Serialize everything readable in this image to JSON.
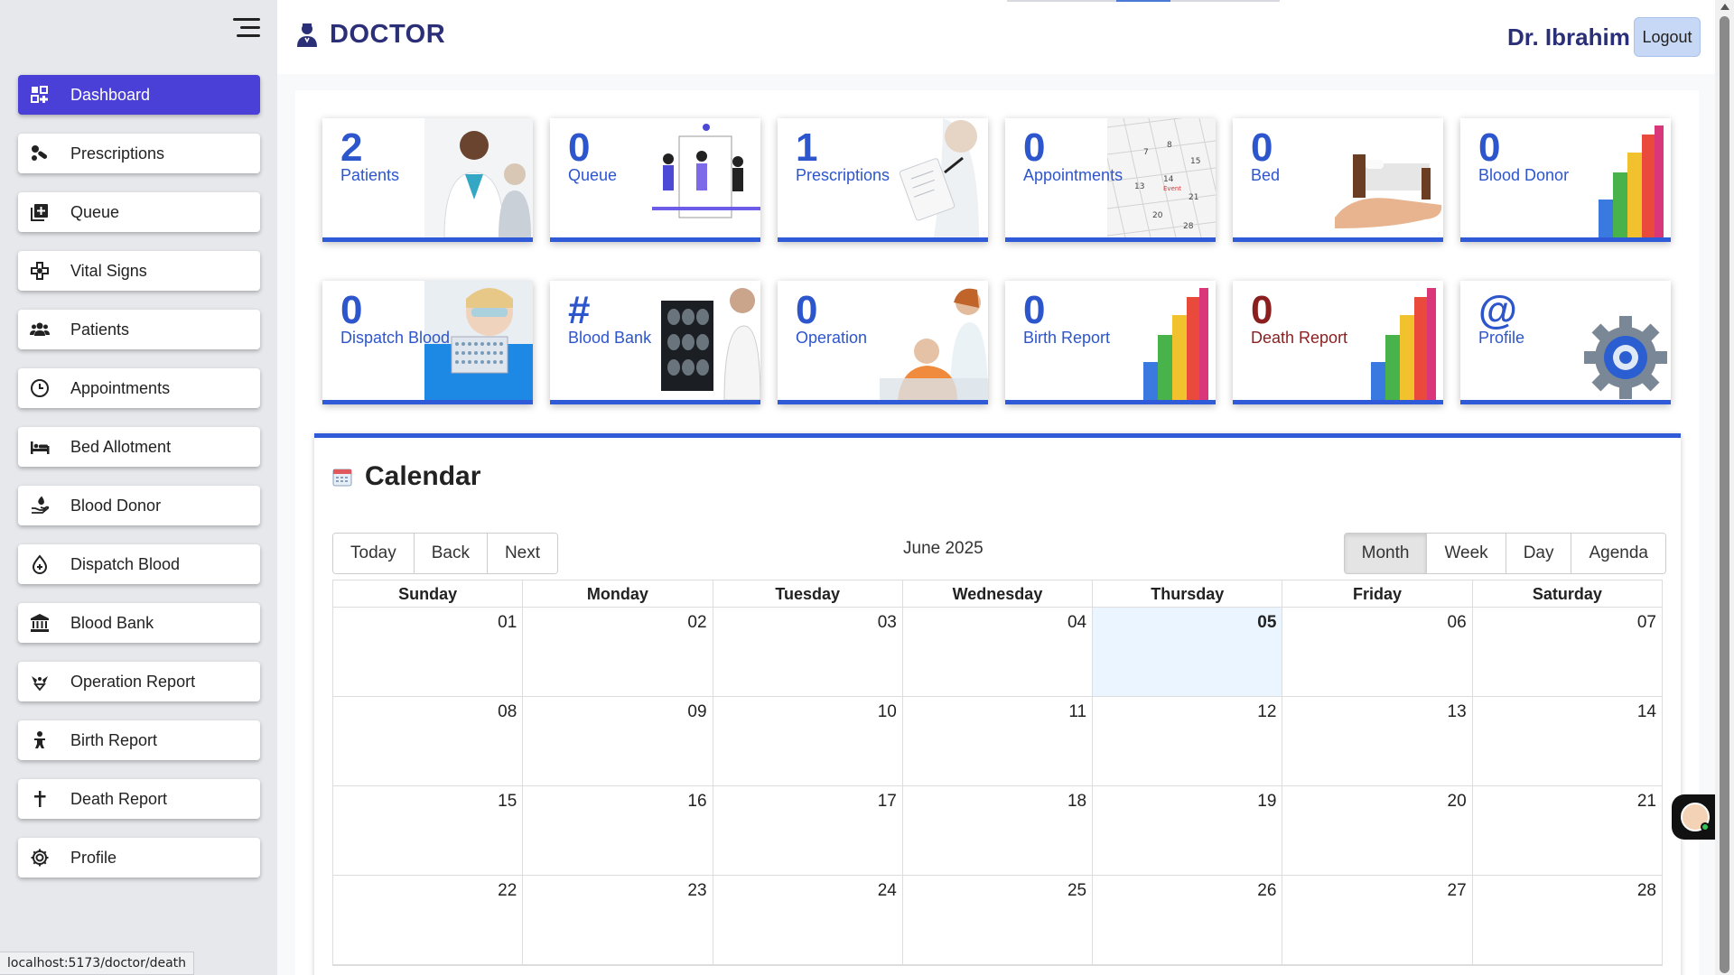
{
  "header": {
    "brand": "DOCTOR",
    "brand_icon": "doctor-icon",
    "user_name": "Dr. Ibrahim",
    "logout_label": "Logout"
  },
  "sidebar": {
    "items": [
      {
        "label": "Dashboard",
        "icon": "dashboard-icon",
        "active": true
      },
      {
        "label": "Prescriptions",
        "icon": "pills-icon"
      },
      {
        "label": "Queue",
        "icon": "queue-add-icon"
      },
      {
        "label": "Vital Signs",
        "icon": "medical-cross-icon"
      },
      {
        "label": "Patients",
        "icon": "users-icon"
      },
      {
        "label": "Appointments",
        "icon": "clock-icon"
      },
      {
        "label": "Bed Allotment",
        "icon": "bed-icon"
      },
      {
        "label": "Blood Donor",
        "icon": "hand-donate-icon"
      },
      {
        "label": "Dispatch Blood",
        "icon": "blood-drop-icon"
      },
      {
        "label": "Blood Bank",
        "icon": "bank-icon"
      },
      {
        "label": "Operation Report",
        "icon": "surgery-icon"
      },
      {
        "label": "Birth Report",
        "icon": "baby-icon"
      },
      {
        "label": "Death Report",
        "icon": "cross-icon"
      },
      {
        "label": "Profile",
        "icon": "gear-icon"
      }
    ]
  },
  "status_url": "localhost:5173/doctor/death",
  "cards": [
    {
      "value": "2",
      "label": "Patients",
      "art": "doctor-patient-image"
    },
    {
      "value": "0",
      "label": "Queue",
      "art": "queue-people-image"
    },
    {
      "value": "1",
      "label": "Prescriptions",
      "art": "prescription-clipboard-image"
    },
    {
      "value": "0",
      "label": "Appointments",
      "art": "calendar-page-image"
    },
    {
      "value": "0",
      "label": "Bed",
      "art": "bed-in-hand-image"
    },
    {
      "value": "0",
      "label": "Blood Donor",
      "art": "bar-chart-image"
    },
    {
      "value": "0",
      "label": "Dispatch Blood",
      "art": "lab-scientist-image"
    },
    {
      "value": "#",
      "label": "Blood Bank",
      "art": "xray-doctor-image"
    },
    {
      "value": "0",
      "label": "Operation",
      "art": "nurse-patient-image"
    },
    {
      "value": "0",
      "label": "Birth Report",
      "art": "bar-chart-image"
    },
    {
      "value": "0",
      "label": "Death Report",
      "art": "bar-chart-image",
      "dark": true
    },
    {
      "value": "@",
      "label": "Profile",
      "art": "gear-image"
    }
  ],
  "calendar": {
    "title": "Calendar",
    "nav_buttons": [
      "Today",
      "Back",
      "Next"
    ],
    "label": "June 2025",
    "views": [
      "Month",
      "Week",
      "Day",
      "Agenda"
    ],
    "active_view": "Month",
    "weekdays": [
      "Sunday",
      "Monday",
      "Tuesday",
      "Wednesday",
      "Thursday",
      "Friday",
      "Saturday"
    ],
    "weeks": [
      [
        "01",
        "02",
        "03",
        "04",
        "05",
        "06",
        "07"
      ],
      [
        "08",
        "09",
        "10",
        "11",
        "12",
        "13",
        "14"
      ],
      [
        "15",
        "16",
        "17",
        "18",
        "19",
        "20",
        "21"
      ],
      [
        "22",
        "23",
        "24",
        "25",
        "26",
        "27",
        "28"
      ]
    ],
    "today": "05"
  },
  "colors": {
    "accent": "#4a3fd6",
    "card_blue": "#2d55cc",
    "card_dark_red": "#8a1f1f",
    "brand_navy": "#2b2f77"
  }
}
